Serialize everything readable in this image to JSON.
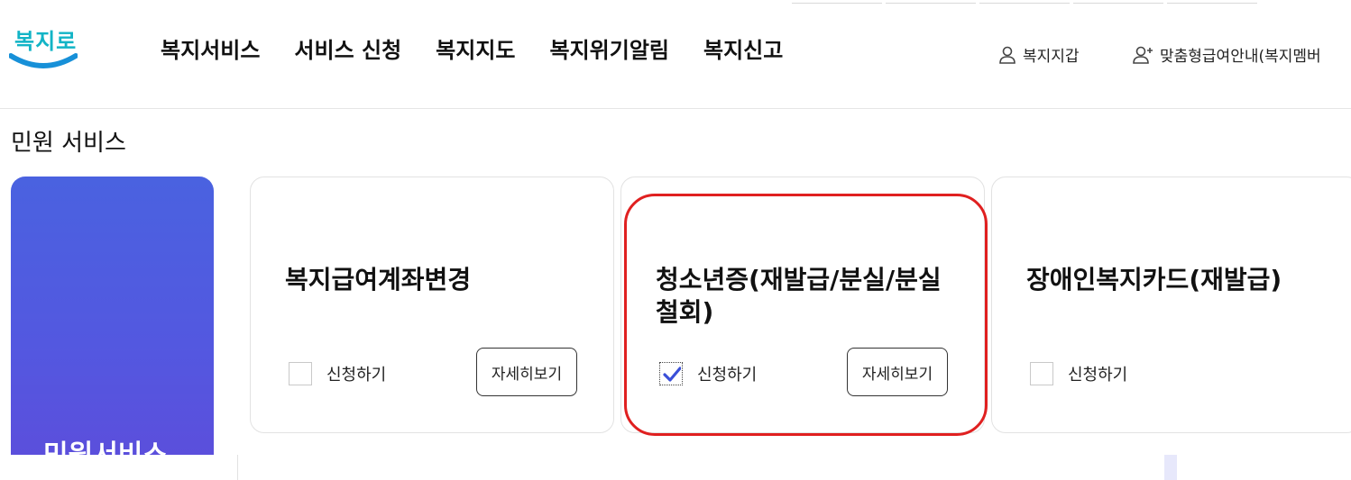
{
  "brand": {
    "logo_text": "복지로",
    "color": "#12b4c6"
  },
  "gnb": [
    "복지서비스",
    "서비스 신청",
    "복지지도",
    "복지위기알림",
    "복지신고"
  ],
  "util": {
    "wallet": "복지지갑",
    "custom": "맞춤형급여안내(복지멤버"
  },
  "page_title": "민원 서비스",
  "banner": {
    "title": "민원서비스",
    "color_start": "#4a62e0",
    "color_end": "#5b4fdc"
  },
  "cards": [
    {
      "title": "복지급여계좌변경",
      "apply_label": "신청하기",
      "apply_checked": false,
      "detail_label": "자세히보기"
    },
    {
      "title": "청소년증(재발급/분실/분실철회)",
      "apply_label": "신청하기",
      "apply_checked": true,
      "detail_label": "자세히보기"
    },
    {
      "title": "장애인복지카드(재발급)",
      "apply_label": "신청하기",
      "apply_checked": false
    }
  ],
  "colors": {
    "highlight": "#e02020",
    "check": "#3a4fd8"
  }
}
